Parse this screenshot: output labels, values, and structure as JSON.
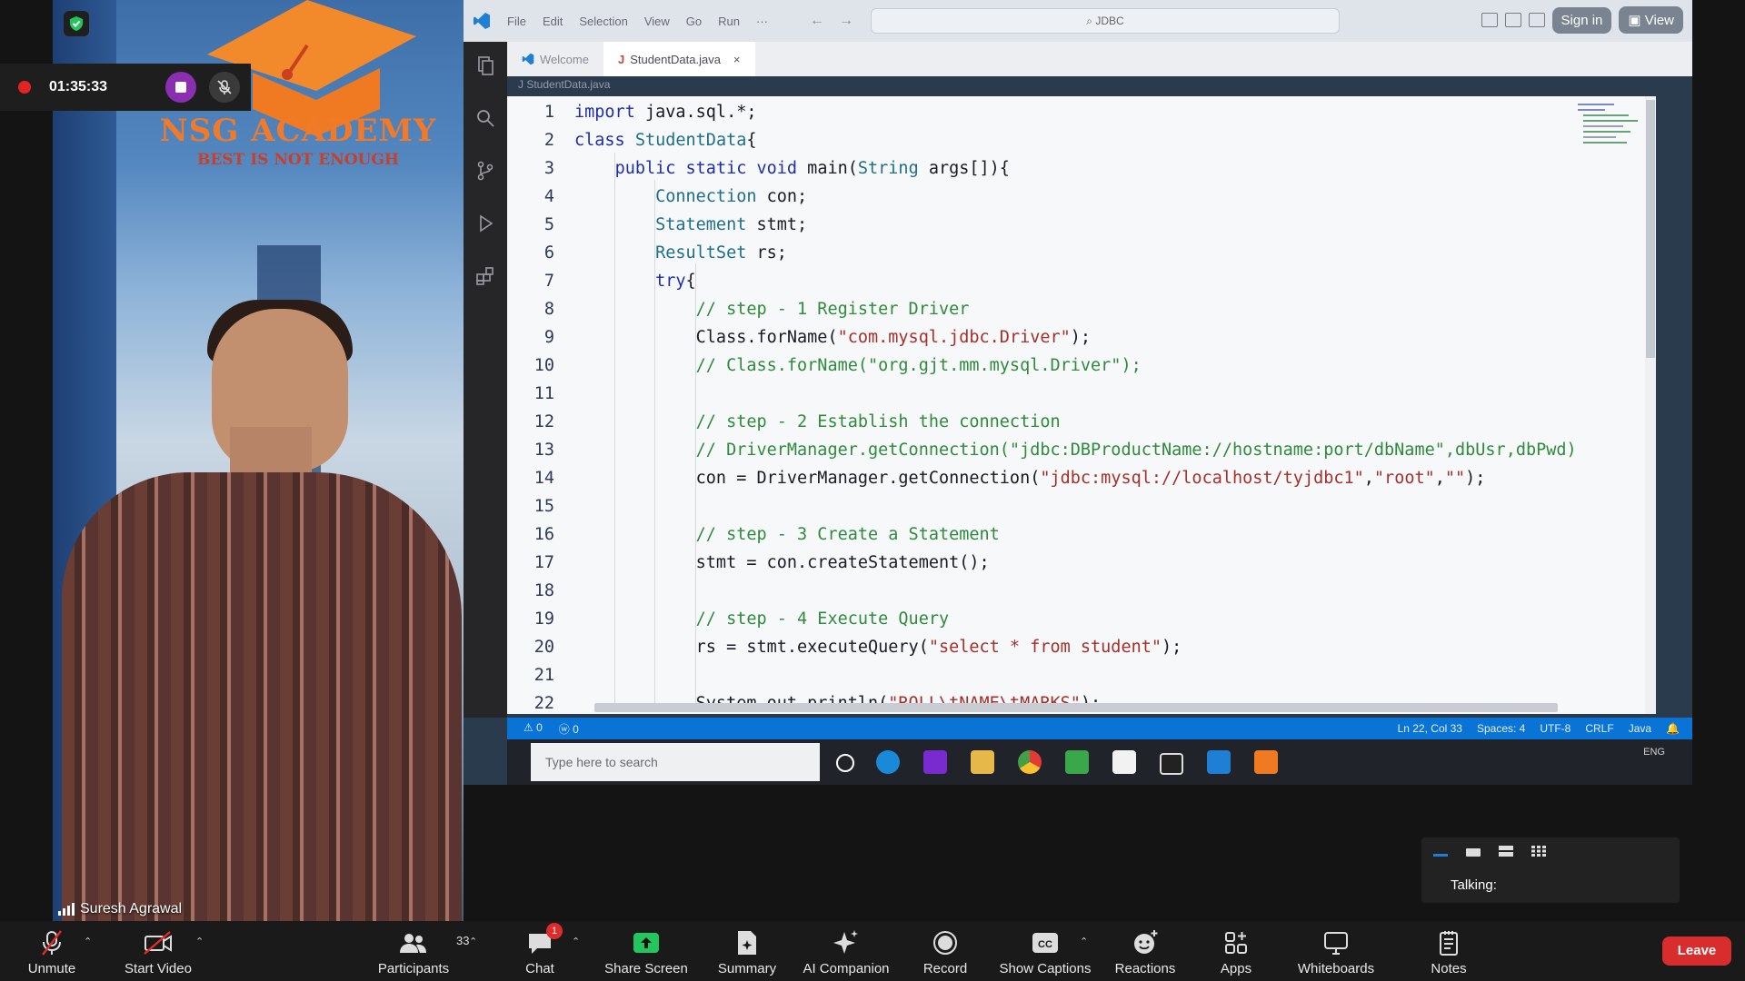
{
  "meeting": {
    "recording_time": "01:35:33",
    "presenter_name": "Suresh Agrawal",
    "talking_label": "Talking:"
  },
  "academy": {
    "title": "NSG ACADEMY",
    "tagline": "BEST IS NOT ENOUGH"
  },
  "vscode": {
    "menu": [
      "File",
      "Edit",
      "Selection",
      "View",
      "Go",
      "Run",
      "···"
    ],
    "search_text": "⌕ JDBC",
    "sign_in": "Sign in",
    "view": "View",
    "tabs": [
      {
        "label": "Welcome"
      },
      {
        "label": "StudentData.java"
      }
    ],
    "breadcrumb": "J StudentData.java",
    "status": {
      "errors": "⚠ 0",
      "warnings": "ⓦ 0",
      "position": "Ln 22, Col 33",
      "spaces": "Spaces: 4",
      "encoding": "UTF-8",
      "eol": "CRLF",
      "language": "Java"
    }
  },
  "code_lines": [
    {
      "n": "1",
      "html": "<span class=\"kw\">import</span> java.sql.*;"
    },
    {
      "n": "2",
      "html": "<span class=\"kw\">class</span> <span class=\"tp\">StudentData</span>{"
    },
    {
      "n": "3",
      "html": "    <span class=\"kw\">public static void</span> main(<span class=\"tp\">String</span> args[]){"
    },
    {
      "n": "4",
      "html": "        <span class=\"tp\">Connection</span> con;"
    },
    {
      "n": "5",
      "html": "        <span class=\"tp\">Statement</span> stmt;"
    },
    {
      "n": "6",
      "html": "        <span class=\"tp\">ResultSet</span> rs;"
    },
    {
      "n": "7",
      "html": "        <span class=\"kw\">try</span>{"
    },
    {
      "n": "8",
      "html": "            <span class=\"cm\">// step - 1 Register Driver</span>"
    },
    {
      "n": "9",
      "html": "            Class.forName(<span class=\"st\">\"com.mysql.jdbc.Driver\"</span>);"
    },
    {
      "n": "10",
      "html": "            <span class=\"cm\">// Class.forName(\"org.gjt.mm.mysql.Driver\");</span>"
    },
    {
      "n": "11",
      "html": ""
    },
    {
      "n": "12",
      "html": "            <span class=\"cm\">// step - 2 Establish the connection</span>"
    },
    {
      "n": "13",
      "html": "            <span class=\"cm\">// DriverManager.getConnection(\"jdbc:DBProductName://hostname:port/dbName\",dbUsr,dbPwd)</span>"
    },
    {
      "n": "14",
      "html": "            con = DriverManager.getConnection(<span class=\"st\">\"jdbc:mysql://localhost/tyjdbc1\"</span>,<span class=\"st\">\"root\"</span>,<span class=\"st\">\"\"</span>);"
    },
    {
      "n": "15",
      "html": ""
    },
    {
      "n": "16",
      "html": "            <span class=\"cm\">// step - 3 Create a Statement</span>"
    },
    {
      "n": "17",
      "html": "            stmt = con.createStatement();"
    },
    {
      "n": "18",
      "html": ""
    },
    {
      "n": "19",
      "html": "            <span class=\"cm\">// step - 4 Execute Query</span>"
    },
    {
      "n": "20",
      "html": "            rs = stmt.executeQuery(<span class=\"st\">\"select * from student\"</span>);"
    },
    {
      "n": "21",
      "html": ""
    },
    {
      "n": "22",
      "html": "            System.out.println(<span class=\"st\">\"ROLL\\tNAME\\tMARKS\"</span>);"
    }
  ],
  "taskbar": {
    "search_placeholder": "Type here to search",
    "tray_text": "ENG"
  },
  "toolbar": {
    "unmute": "Unmute",
    "start_video": "Start Video",
    "participants": "Participants",
    "participants_count": "33",
    "chat": "Chat",
    "chat_badge": "1",
    "share_screen": "Share Screen",
    "summary": "Summary",
    "ai_companion": "AI Companion",
    "record": "Record",
    "show_captions": "Show Captions",
    "reactions": "Reactions",
    "apps": "Apps",
    "whiteboards": "Whiteboards",
    "notes": "Notes",
    "leave": "Leave"
  },
  "colors": {
    "leave": "#d92d2d",
    "share_green": "#22c55e",
    "vscode_status": "#0a74d6",
    "record_dot": "#e02424"
  }
}
